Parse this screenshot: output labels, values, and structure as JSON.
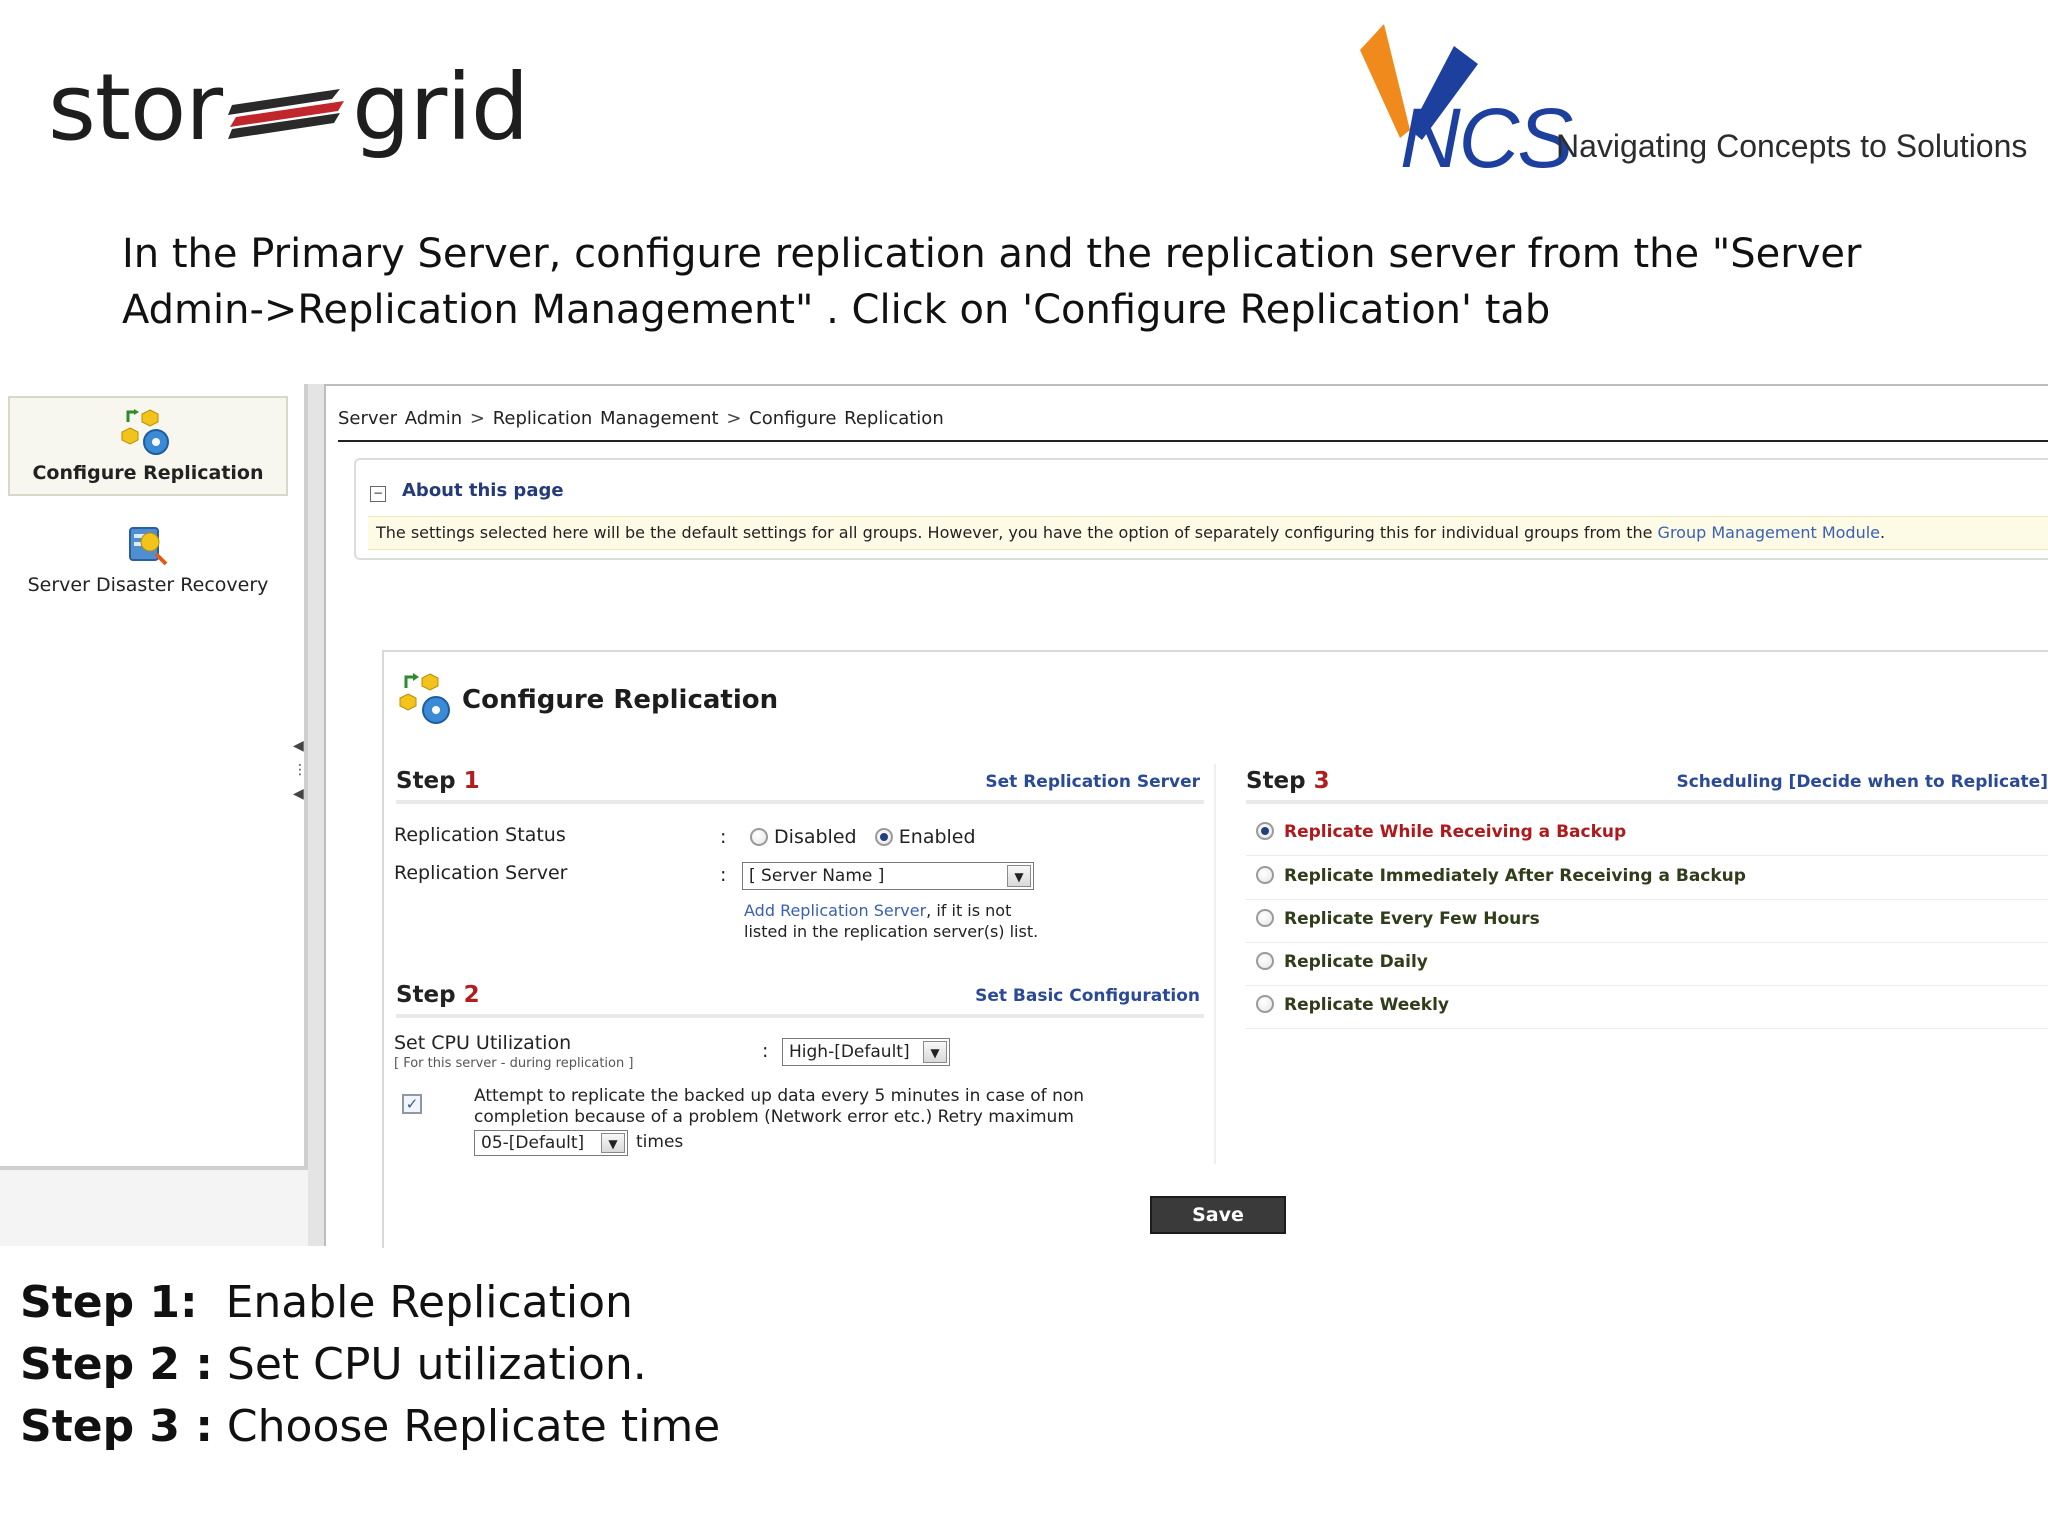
{
  "header": {
    "storgrid_logo": {
      "left": "stor",
      "right": "grid"
    },
    "ncs_logo": {
      "text": "NCS",
      "tagline": "Navigating Concepts to Solutions"
    }
  },
  "instruction": "In the Primary Server, configure replication and the replication server from the \"Server Admin->Replication Management\" . Click on 'Configure Replication' tab",
  "sidebar": {
    "items": [
      {
        "label": "Configure Replication",
        "icon": "gears-replication-icon",
        "active": true
      },
      {
        "label": "Server Disaster Recovery",
        "icon": "server-recovery-icon",
        "active": false
      }
    ]
  },
  "breadcrumb": {
    "items": [
      "Server Admin",
      "Replication Management",
      "Configure Replication"
    ],
    "separator": ">"
  },
  "about": {
    "title": "About this page",
    "body": "The settings selected here will be the default settings for all groups. However, you have the option of separately configuring this for individual groups from the",
    "link": "Group Management Module",
    "end": "."
  },
  "panel": {
    "title": "Configure Replication",
    "step1": {
      "label": "Step",
      "num": "1",
      "link": "Set Replication Server",
      "status_label": "Replication Status",
      "status_options": [
        "Disabled",
        "Enabled"
      ],
      "status_selected": "Enabled",
      "server_label": "Replication Server",
      "server_value": "[ Server Name ]",
      "add_link": "Add Replication Server",
      "add_note_1": ", if it is not",
      "add_note_2": "listed in the replication server(s) list."
    },
    "step2": {
      "label": "Step",
      "num": "2",
      "link": "Set Basic Configuration",
      "cpu_label": "Set CPU Utilization",
      "cpu_hint": "[ For this server - during replication ]",
      "cpu_value": "High-[Default]",
      "retry_checked": true,
      "retry_text_1": "Attempt to replicate the backed up data every 5 minutes in case of non",
      "retry_text_2": "completion because of a problem (Network error etc.) Retry maximum",
      "retry_value": "05-[Default]",
      "retry_suffix": "times"
    },
    "step3": {
      "label": "Step",
      "num": "3",
      "link": "Scheduling [Decide when to Replicate]",
      "options": [
        "Replicate While Receiving a Backup",
        "Replicate Immediately After Receiving a Backup",
        "Replicate Every Few Hours",
        "Replicate Daily",
        "Replicate Weekly"
      ],
      "selected": "Replicate While Receiving a Backup"
    },
    "colon": ":",
    "save_label": "Save"
  },
  "steps_summary": [
    {
      "head": "Step 1:",
      "text": "  Enable Replication"
    },
    {
      "head": "Step 2 :",
      "text": " Set CPU utilization."
    },
    {
      "head": "Step 3 :",
      "text": " Choose Replicate time"
    }
  ],
  "colors": {
    "accent_blue": "#2a4a98",
    "step_red": "#b01e1e",
    "selected_option": "#b0191b",
    "note_bg": "#fdfbe6"
  }
}
